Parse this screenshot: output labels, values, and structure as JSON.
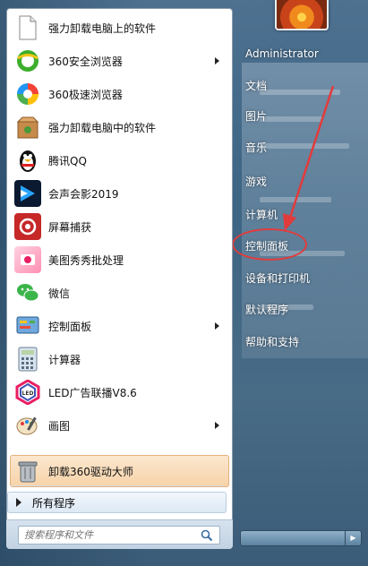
{
  "programs": [
    {
      "label": "强力卸载电脑上的软件",
      "icon": "document-icon"
    },
    {
      "label": "360安全浏览器",
      "icon": "360-browser-icon"
    },
    {
      "label": "360极速浏览器",
      "icon": "360-speed-browser-icon"
    },
    {
      "label": "强力卸载电脑中的软件",
      "icon": "uninstall-box-icon"
    },
    {
      "label": "腾讯QQ",
      "icon": "qq-penguin-icon"
    },
    {
      "label": "会声会影2019",
      "icon": "video-studio-icon"
    },
    {
      "label": "屏幕捕获",
      "icon": "screen-capture-icon"
    },
    {
      "label": "美图秀秀批处理",
      "icon": "meitu-icon"
    },
    {
      "label": "微信",
      "icon": "wechat-icon"
    },
    {
      "label": "控制面板",
      "icon": "control-panel-icon"
    },
    {
      "label": "计算器",
      "icon": "calculator-icon"
    },
    {
      "label": "LED广告联播V8.6",
      "icon": "led-icon"
    },
    {
      "label": "画图",
      "icon": "paint-icon"
    },
    {
      "label": "卸载360驱动大师",
      "icon": "trash-can-icon"
    }
  ],
  "all_programs": "所有程序",
  "search": {
    "placeholder": "搜索程序和文件"
  },
  "right_menu": {
    "user": "Administrator",
    "documents": "文档",
    "pictures": "图片",
    "music": "音乐",
    "games": "游戏",
    "computer": "计算机",
    "control_panel": "控制面板",
    "devices_printers": "设备和打印机",
    "default_programs": "默认程序",
    "help_support": "帮助和支持"
  },
  "colors": {
    "highlight": "#f7d3a8",
    "annotation": "#e23b3b",
    "glass": "#4e7190"
  }
}
